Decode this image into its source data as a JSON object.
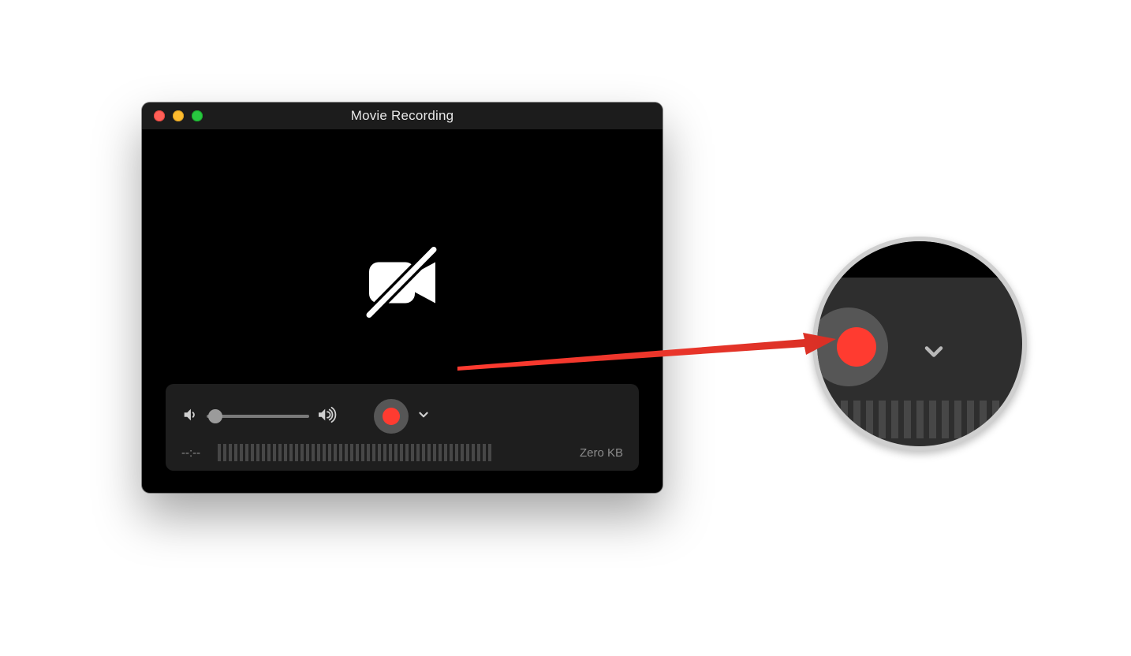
{
  "window": {
    "title": "Movie Recording",
    "time_elapsed": "--:--",
    "file_size": "Zero KB"
  },
  "colors": {
    "record_red": "#ff3b30",
    "traffic_red": "#ff5f57",
    "traffic_yellow": "#febc2e",
    "traffic_green": "#28c840"
  }
}
